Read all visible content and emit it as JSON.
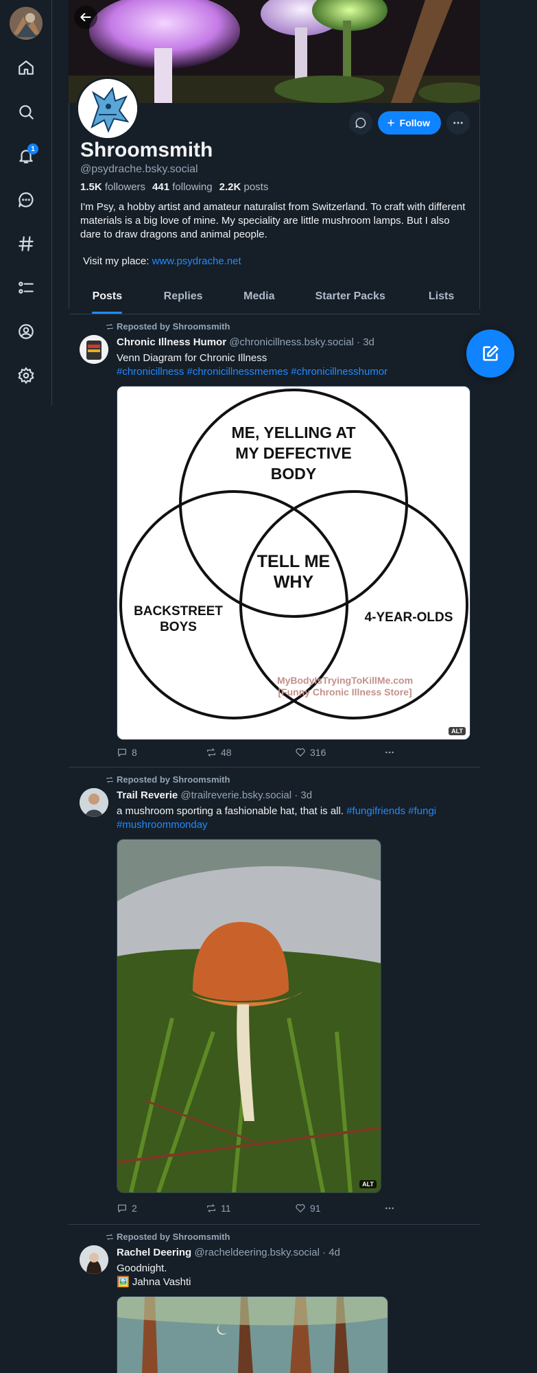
{
  "nav": {
    "notifications_badge": "1"
  },
  "profile": {
    "name": "Shroomsmith",
    "handle": "@psydrache.bsky.social",
    "followers_count": "1.5K",
    "followers_label": "followers",
    "following_count": "441",
    "following_label": "following",
    "posts_count": "2.2K",
    "posts_label": "posts",
    "bio": "I'm Psy, a hobby artist and amateur naturalist from Switzerland. To craft with different materials is a big love of mine. My speciality are little mushroom lamps. But I also dare to draw dragons and animal people.",
    "visit_label": "Visit my place:",
    "visit_link": "www.psydrache.net",
    "follow_label": "Follow"
  },
  "tabs": [
    "Posts",
    "Replies",
    "Media",
    "Starter Packs",
    "Lists"
  ],
  "posts": [
    {
      "repost_label": "Reposted by Shroomsmith",
      "author": "Chronic Illness Humor",
      "handle": "@chronicillness.bsky.social · 3d",
      "text": "Venn Diagram for Chronic Illness",
      "tags": "#chronicillness #chronicillnessmemes #chronicillnesshumor",
      "image": {
        "top": "ME, YELLING AT MY DEFECTIVE BODY",
        "left": "BACKSTREET BOYS",
        "right": "4-YEAR-OLDS",
        "center": "TELL ME WHY",
        "watermark1": "MyBodyIsTryingToKillMe.com",
        "watermark2": "[Funny Chronic Illness Store]",
        "alt": "ALT"
      },
      "replies": "8",
      "reposts": "48",
      "likes": "316"
    },
    {
      "repost_label": "Reposted by Shroomsmith",
      "author": "Trail Reverie",
      "handle": "@trailreverie.bsky.social · 3d",
      "text": "a mushroom sporting a fashionable hat, that is all.",
      "tags_inline": "#fungifriends #fungi",
      "tags_line2": "#mushroommonday",
      "alt": "ALT",
      "replies": "2",
      "reposts": "11",
      "likes": "91"
    },
    {
      "repost_label": "Reposted by Shroomsmith",
      "author": "Rachel Deering",
      "handle": "@racheldeering.bsky.social · 4d",
      "text": "Goodnight.",
      "text2": "🖼️ Jahna Vashti"
    }
  ]
}
